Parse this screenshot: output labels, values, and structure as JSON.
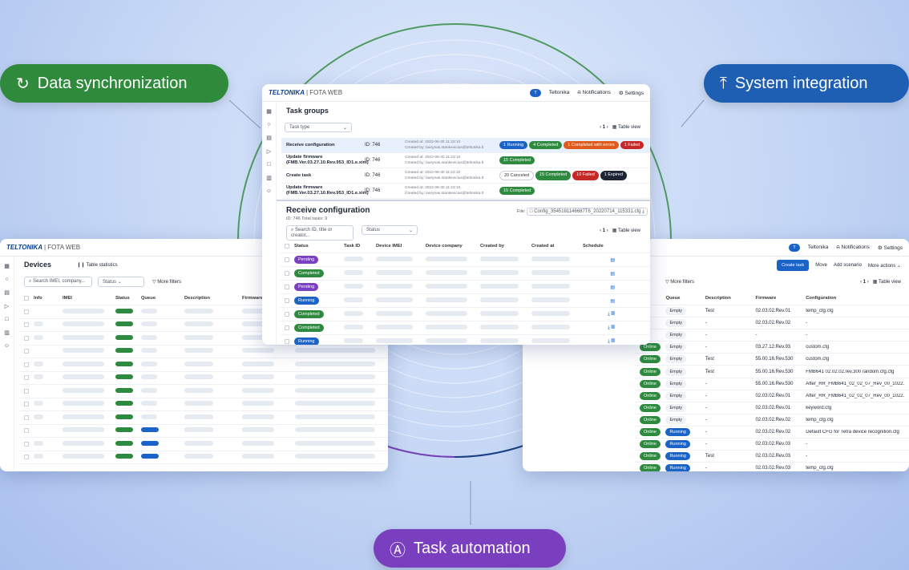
{
  "pills": {
    "sync": "Data synchronization",
    "integration": "System integration",
    "automation": "Task automation"
  },
  "colors": {
    "sync": "#2f8a3b",
    "integration": "#1e5fb3",
    "automation": "#7a3fbf"
  },
  "icons": {
    "sync": "refresh-icon",
    "integration": "upload-icon",
    "automation": "automation-icon"
  },
  "app": {
    "brand": "TELTONIKA",
    "product": "FOTA WEB",
    "user": "Teltonika",
    "user_initial": "T",
    "notifications": "Notifications",
    "settings": "Settings"
  },
  "task_groups": {
    "title": "Task groups",
    "filter_placeholder": "Task type",
    "page": "1",
    "view": "Table view",
    "rows": [
      {
        "name": "Receive configuration",
        "id": "ID: 746",
        "created_at": "Created at: 2022-06-30 11:23:10",
        "created_by": "Created by: laurynas.stankevicius@teltonika.lt",
        "badges": [
          {
            "t": "1 Running",
            "c": "bl"
          },
          {
            "t": "4 Completed",
            "c": "gr"
          },
          {
            "t": "1 Completed with errors",
            "c": "or"
          },
          {
            "t": "1 Failed",
            "c": "rd"
          }
        ]
      },
      {
        "name": "Update firmware",
        "name2": "(FMB.Ver.03.27.10.Rev.953_ID1.e.xim)",
        "id": "ID: 746",
        "created_at": "Created at: 2022-06-30 11:23:10",
        "created_by": "Created by: laurynas.stankevicius@teltonika.lt",
        "badges": [
          {
            "t": "15 Completed",
            "c": "gr"
          }
        ]
      },
      {
        "name": "Create task",
        "id": "ID: 746",
        "created_at": "Created at: 2022-06-30 11:23:10",
        "created_by": "Created by: laurynas.stankevicius@teltonika.lt",
        "badges": [
          {
            "t": "20 Canceled",
            "c": "none"
          },
          {
            "t": "15 Completed",
            "c": "gr"
          },
          {
            "t": "10 Failed",
            "c": "rd"
          },
          {
            "t": "1 Expired",
            "c": "dk"
          }
        ]
      },
      {
        "name": "Update firmware",
        "name2": "(FMB.Ver.03.27.10.Rev.953_ID1.e.xim)",
        "id": "ID: 746",
        "created_at": "Created at: 2022-06-30 11:23:10",
        "created_by": "Created by: laurynas.stankevicius@teltonika.lt",
        "badges": [
          {
            "t": "15 Completed",
            "c": "gr"
          }
        ]
      }
    ]
  },
  "receive": {
    "title": "Receive configuration",
    "meta": "ID: 746  Total tasks: 9",
    "file_label": "File:",
    "file": "Config_3545181146687T6_20220714_115331.cfg",
    "search_placeholder": "Search ID, title or creator...",
    "status_placeholder": "Status",
    "page": "1",
    "view": "Table view",
    "cols": [
      "Status",
      "Task ID",
      "Device IMEI",
      "Device company",
      "Created by",
      "Created at",
      "Schedule"
    ],
    "rows": [
      {
        "s": "Pending",
        "c": "pu"
      },
      {
        "s": "Completed",
        "c": "gr"
      },
      {
        "s": "Pending",
        "c": "pu"
      },
      {
        "s": "Running",
        "c": "bl"
      },
      {
        "s": "Completed",
        "c": "gr"
      },
      {
        "s": "Completed",
        "c": "gr"
      },
      {
        "s": "Running",
        "c": "bl"
      }
    ]
  },
  "devices": {
    "title": "Devices",
    "stats": "Table statistics",
    "search_placeholder": "Search IMEI, company...",
    "status_placeholder": "Status",
    "more_filters": "More filters",
    "cols": [
      "Info",
      "IMEI",
      "Status",
      "Queue",
      "Description",
      "Firmware"
    ]
  },
  "right": {
    "create_task": "Create task",
    "move": "Move",
    "add_scenario": "Add scenario",
    "more_actions": "More actions",
    "more_filters": "More filters",
    "page": "1",
    "view": "Table view",
    "cols": [
      "Queue",
      "Description",
      "Firmware",
      "Configuration"
    ],
    "rows": [
      {
        "st": "",
        "q": "Empty",
        "d": "Test",
        "f": "02.03.02.Rev.01",
        "c": "temp_cfg.cfg"
      },
      {
        "st": "",
        "q": "Empty",
        "d": "-",
        "f": "02.03.02.Rev.02",
        "c": "-"
      },
      {
        "st": "",
        "q": "Empty",
        "d": "-",
        "f": "-",
        "c": "-"
      },
      {
        "st": "Online",
        "q": "Empty",
        "d": "-",
        "f": "03.27.12.Rev.93",
        "c": "custom.cfg"
      },
      {
        "st": "Online",
        "q": "Empty",
        "d": "Test",
        "f": "55.00.16.Rev.530",
        "c": "custom.cfg"
      },
      {
        "st": "Online",
        "q": "Empty",
        "d": "Test",
        "f": "55.00.16.Rev.530",
        "c": "FMB641 02.02.02.rev.300 random.cfg.cfg"
      },
      {
        "st": "Online",
        "q": "Empty",
        "d": "-",
        "f": "55.00.16.Rev.530",
        "c": "After_RR_FMB641_02_02_07_Rev_00_1022.cfg"
      },
      {
        "st": "Online",
        "q": "Empty",
        "d": "-",
        "f": "02.03.02.Rev.01",
        "c": "After_RR_FMB641_02_02_07_Rev_00_1022.cfg"
      },
      {
        "st": "Online",
        "q": "Empty",
        "d": "-",
        "f": "02.03.02.Rev.01",
        "c": "keyword.cfg"
      },
      {
        "st": "Online",
        "q": "Empty",
        "d": "-",
        "f": "02.03.02.Rev.02",
        "c": "temp_cfg.cfg"
      },
      {
        "st": "Online",
        "q": "Running",
        "d": "-",
        "f": "02.03.02.Rev.02",
        "c": "Default CFG for Tetra device recognition.cfg"
      },
      {
        "st": "Online",
        "q": "Running",
        "d": "-",
        "f": "02.03.02.Rev.03",
        "c": "-"
      },
      {
        "st": "Online",
        "q": "Running",
        "d": "Test",
        "f": "02.03.02.Rev.03",
        "c": "-"
      },
      {
        "st": "Online",
        "q": "Running",
        "d": "-",
        "f": "02.03.02.Rev.03",
        "c": "temp_cfg.cfg"
      }
    ]
  }
}
